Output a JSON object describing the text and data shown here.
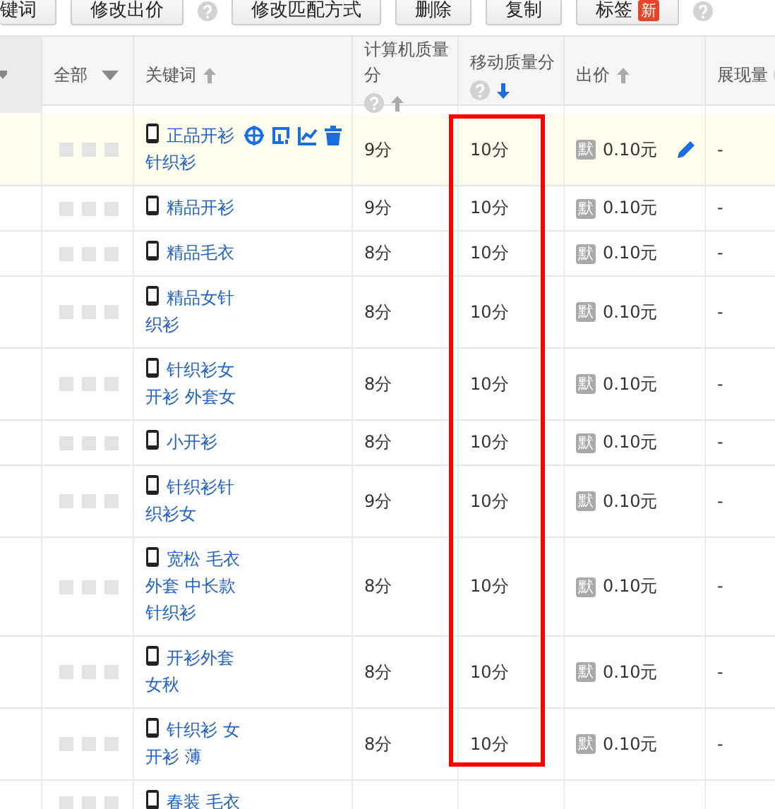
{
  "toolbar": [
    {
      "label": "键词",
      "help": false
    },
    {
      "label": "修改出价",
      "help": true
    },
    {
      "label": "修改匹配方式",
      "help": false
    },
    {
      "label": "删除",
      "help": false
    },
    {
      "label": "复制",
      "help": false
    },
    {
      "label": "标签",
      "badge": "新",
      "help": true
    }
  ],
  "table": {
    "columns": [
      {
        "kind": "menu",
        "framed": false
      },
      {
        "kind": "filter",
        "label": "全部",
        "framed": false
      },
      {
        "kind": "text",
        "label": "关键词",
        "help": false,
        "sorted": false,
        "framed": false
      },
      {
        "kind": "text",
        "label": "计算机质量分",
        "help": true,
        "sorted": false,
        "framed": false
      },
      {
        "kind": "text",
        "label": "移动质量分",
        "help": true,
        "sorted": true,
        "framed": true
      },
      {
        "kind": "text",
        "label": "出价",
        "help": false,
        "sorted": false,
        "framed": false
      },
      {
        "kind": "text",
        "label": "展现量",
        "help": true,
        "framed": false
      }
    ],
    "rows": [
      {
        "hovered": true,
        "keyword": "正品开衫针织衫",
        "pc_score": "9分",
        "mobile_score": "10分",
        "price_badge": "默",
        "price": "0.10元",
        "impressions": "-"
      },
      {
        "hovered": false,
        "keyword": "精品开衫",
        "pc_score": "9分",
        "mobile_score": "10分",
        "price_badge": "默",
        "price": "0.10元",
        "impressions": "-"
      },
      {
        "hovered": false,
        "keyword": "精品毛衣",
        "pc_score": "8分",
        "mobile_score": "10分",
        "price_badge": "默",
        "price": "0.10元",
        "impressions": "-"
      },
      {
        "hovered": false,
        "keyword": "精品女针织衫",
        "pc_score": "8分",
        "mobile_score": "10分",
        "price_badge": "默",
        "price": "0.10元",
        "impressions": "-"
      },
      {
        "hovered": false,
        "keyword": "针织衫女开衫 外套女",
        "pc_score": "8分",
        "mobile_score": "10分",
        "price_badge": "默",
        "price": "0.10元",
        "impressions": "-"
      },
      {
        "hovered": false,
        "keyword": "小开衫",
        "pc_score": "8分",
        "mobile_score": "10分",
        "price_badge": "默",
        "price": "0.10元",
        "impressions": "-"
      },
      {
        "hovered": false,
        "keyword": "针织衫针织衫女",
        "pc_score": "9分",
        "mobile_score": "10分",
        "price_badge": "默",
        "price": "0.10元",
        "impressions": "-"
      },
      {
        "hovered": false,
        "keyword": "宽松 毛衣外套 中长款针织衫",
        "pc_score": "8分",
        "mobile_score": "10分",
        "price_badge": "默",
        "price": "0.10元",
        "impressions": "-"
      },
      {
        "hovered": false,
        "keyword": "开衫外套女秋",
        "pc_score": "8分",
        "mobile_score": "10分",
        "price_badge": "默",
        "price": "0.10元",
        "impressions": "-"
      },
      {
        "hovered": false,
        "keyword": "针织衫 女开衫 薄",
        "pc_score": "8分",
        "mobile_score": "10分",
        "price_badge": "默",
        "price": "0.10元",
        "impressions": "-"
      },
      {
        "hovered": false,
        "keyword": "春装 毛衣"
      }
    ]
  }
}
